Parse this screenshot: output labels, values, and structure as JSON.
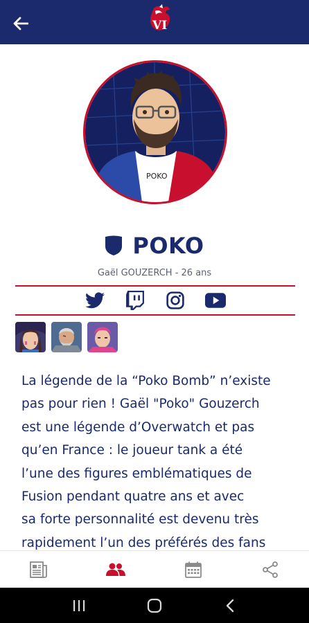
{
  "header": {
    "logo_text": "VI",
    "back_icon": "arrow-left-icon"
  },
  "player": {
    "name": "POKO",
    "subtitle": "Gaël GOUZERCH - 26 ans",
    "shirt_text": "POKO"
  },
  "social": [
    {
      "name": "twitter-icon"
    },
    {
      "name": "twitch-icon"
    },
    {
      "name": "instagram-icon"
    },
    {
      "name": "youtube-icon"
    }
  ],
  "heroes": [
    {
      "name": "hero-dva"
    },
    {
      "name": "hero-reinhardt"
    },
    {
      "name": "hero-zarya"
    }
  ],
  "bio": {
    "lines": [
      "La légende de la “Poko Bomb” n’existe",
      "pas pour rien ! Gaël \"Poko\" Gouzerch",
      "est une légende d’Overwatch et pas",
      "qu’en France : le joueur tank a été",
      "l’une des figures emblématiques de",
      "Fusion pendant quatre ans et avec",
      "sa forte personnalité est devenu très",
      "rapidement l’un des préférés des fans"
    ]
  },
  "bottom_nav": [
    {
      "name": "news-icon",
      "active": false
    },
    {
      "name": "team-icon",
      "active": true
    },
    {
      "name": "calendar-icon",
      "active": false
    },
    {
      "name": "share-icon",
      "active": false
    }
  ],
  "colors": {
    "navy": "#1a2a6c",
    "red": "#c8102e",
    "gray_icon": "#8a8a8a"
  }
}
